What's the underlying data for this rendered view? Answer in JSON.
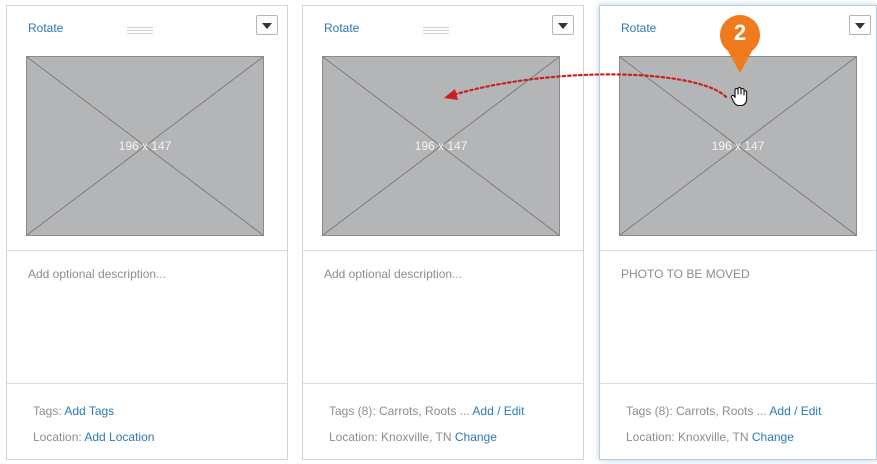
{
  "cards": [
    {
      "rotate_label": "Rotate",
      "image_label": "196 x 147",
      "description": "Add optional description...",
      "tags_prefix": "Tags: ",
      "tags_value": "",
      "tags_link": "Add Tags",
      "location_prefix": "Location: ",
      "location_value": "",
      "location_link": "Add Location"
    },
    {
      "rotate_label": "Rotate",
      "image_label": "196 x 147",
      "description": "Add optional description...",
      "tags_prefix": "Tags (8): ",
      "tags_value": "Carrots, Roots ... ",
      "tags_link": "Add / Edit",
      "location_prefix": "Location: ",
      "location_value": "Knoxville, TN  ",
      "location_link": "Change"
    },
    {
      "rotate_label": "Rotate",
      "image_label": "196 x 147",
      "description": "PHOTO TO BE MOVED",
      "tags_prefix": "Tags (8): ",
      "tags_value": "Carrots, Roots ... ",
      "tags_link": "Add / Edit",
      "location_prefix": "Location: ",
      "location_value": "Knoxville, TN  ",
      "location_link": "Change"
    }
  ],
  "step_badge": "2",
  "colors": {
    "link": "#2a7ab8",
    "badge": "#f07a1e",
    "arrow": "#cc2020",
    "placeholder": "#b4b5b7"
  },
  "icons": [
    "grip-handle-icon",
    "chevron-down-icon",
    "step-marker-icon",
    "drag-hand-icon",
    "drag-arrow-icon"
  ]
}
